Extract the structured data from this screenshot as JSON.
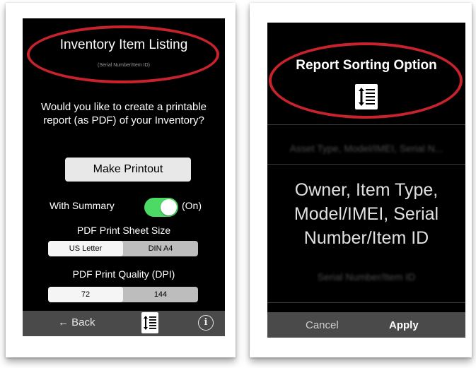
{
  "left_screen": {
    "title": "Inventory Item Listing",
    "subtitle": "(Serial Number/Item ID)",
    "question": "Would you like to create a printable report (as PDF) of your Inventory?",
    "make_printout_label": "Make Printout",
    "summary_label": "With Summary",
    "summary_state": "(On)",
    "summary_on": true,
    "sheet_size_label": "PDF Print Sheet Size",
    "sheet_size_options": [
      "US Letter",
      "DIN A4"
    ],
    "sheet_size_selected": "US Letter",
    "quality_label": "PDF Print Quality (DPI)",
    "quality_options": [
      "72",
      "144"
    ],
    "quality_selected": "72",
    "back_label": "← Back",
    "sort_icon": "sort-list-icon",
    "info_icon": "info-icon"
  },
  "right_screen": {
    "title": "Report Sorting Option",
    "sort_icon": "sort-list-icon",
    "picker_above": "Asset Type, Model/IMEI, Serial N...",
    "selected_option": "Owner, Item Type, Model/IMEI, Serial Number/Item ID",
    "picker_below": "Serial Number/Item ID",
    "cancel_label": "Cancel",
    "apply_label": "Apply"
  },
  "colors": {
    "highlight_ring": "#c8232c",
    "toggle_on": "#4cd964",
    "bar": "#4a4a4a"
  }
}
